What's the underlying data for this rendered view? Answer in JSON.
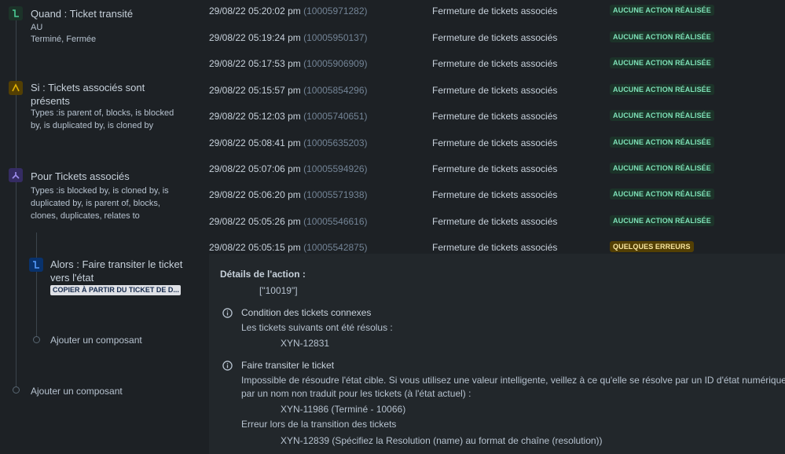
{
  "rule": {
    "trigger": {
      "title": "Quand : Ticket transité",
      "sub1": "AU",
      "sub2": "Terminé, Fermée",
      "icon": "transition-icon",
      "color": "#1f845a"
    },
    "condition": {
      "title_line1": "Si : Tickets associés sont",
      "title_line2": "présents",
      "sub1": "Types :is parent of, blocks, is blocked",
      "sub2": "by, is duplicated by, is cloned by",
      "icon": "condition-icon",
      "color": "#946f00"
    },
    "branch": {
      "title": "Pour Tickets associés",
      "sub1": "Types :is blocked by, is cloned by, is",
      "sub2": "duplicated by, is parent of, blocks,",
      "sub3": "clones, duplicates, relates to",
      "icon": "branch-icon",
      "color": "#5e4db2"
    },
    "action": {
      "title_line1": "Alors : Faire transiter le ticket",
      "title_line2": "vers l'état",
      "tag": "COPIER À PARTIR DU TICKET DE D...",
      "icon": "transition-icon",
      "color": "#1d7afc"
    },
    "add_inner": "Ajouter un composant",
    "add_outer": "Ajouter un composant"
  },
  "log": {
    "rows": [
      {
        "time": "29/08/22 05:20:02 pm",
        "id": "(10005971282)",
        "action": "Fermeture de tickets associés",
        "status": "AUCUNE ACTION RÉALISÉE",
        "kind": "success"
      },
      {
        "time": "29/08/22 05:19:24 pm",
        "id": "(10005950137)",
        "action": "Fermeture de tickets associés",
        "status": "AUCUNE ACTION RÉALISÉE",
        "kind": "success"
      },
      {
        "time": "29/08/22 05:17:53 pm",
        "id": "(10005906909)",
        "action": "Fermeture de tickets associés",
        "status": "AUCUNE ACTION RÉALISÉE",
        "kind": "success"
      },
      {
        "time": "29/08/22 05:15:57 pm",
        "id": "(10005854296)",
        "action": "Fermeture de tickets associés",
        "status": "AUCUNE ACTION RÉALISÉE",
        "kind": "success"
      },
      {
        "time": "29/08/22 05:12:03 pm",
        "id": "(10005740651)",
        "action": "Fermeture de tickets associés",
        "status": "AUCUNE ACTION RÉALISÉE",
        "kind": "success"
      },
      {
        "time": "29/08/22 05:08:41 pm",
        "id": "(10005635203)",
        "action": "Fermeture de tickets associés",
        "status": "AUCUNE ACTION RÉALISÉE",
        "kind": "success"
      },
      {
        "time": "29/08/22 05:07:06 pm",
        "id": "(10005594926)",
        "action": "Fermeture de tickets associés",
        "status": "AUCUNE ACTION RÉALISÉE",
        "kind": "success"
      },
      {
        "time": "29/08/22 05:06:20 pm",
        "id": "(10005571938)",
        "action": "Fermeture de tickets associés",
        "status": "AUCUNE ACTION RÉALISÉE",
        "kind": "success"
      },
      {
        "time": "29/08/22 05:05:26 pm",
        "id": "(10005546616)",
        "action": "Fermeture de tickets associés",
        "status": "AUCUNE ACTION RÉALISÉE",
        "kind": "success"
      },
      {
        "time": "29/08/22 05:05:15 pm",
        "id": "(10005542875)",
        "action": "Fermeture de tickets associés",
        "status": "QUELQUES ERREURS",
        "kind": "warn"
      }
    ]
  },
  "details": {
    "heading": "Détails de l'action :",
    "value": "[\"10019\"]",
    "section1": {
      "title": "Condition des tickets connexes",
      "line": "Les tickets suivants ont été résolus :",
      "item": "XYN-12831"
    },
    "section2": {
      "title": "Faire transiter le ticket",
      "line1": "Impossible de résoudre l'état cible. Si vous utilisez une valeur intelligente, veillez à ce qu'elle se résolve par un ID d'état numérique ou",
      "line2": "par un nom non traduit pour les tickets (à l'état actuel) :",
      "item1": "XYN-11986 (Terminé - 10066)",
      "error_title": "Erreur lors de la transition des tickets",
      "item2": "XYN-12839 (Spécifiez la Resolution (name) au format de chaîne (resolution))"
    },
    "info_icon": "info-icon"
  }
}
